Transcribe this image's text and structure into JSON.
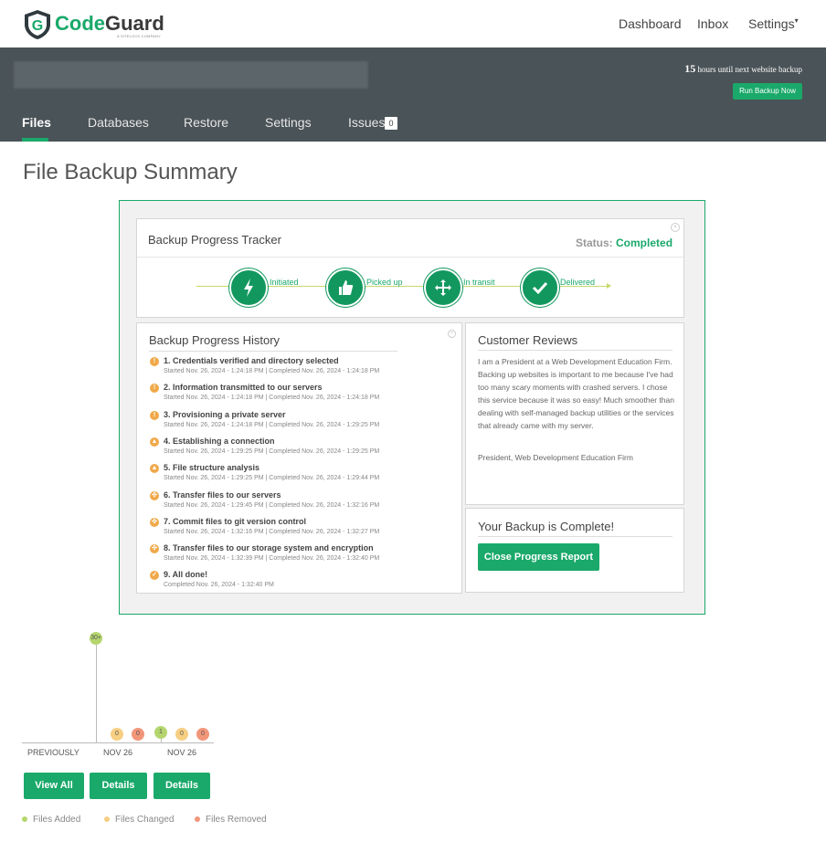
{
  "brand": {
    "name_code": "Code",
    "name_guard": "Guard",
    "tagline": "A SITELOCK COMPANY"
  },
  "topnav": {
    "dashboard": "Dashboard",
    "inbox": "Inbox",
    "settings": "Settings",
    "settings_caret": "▾"
  },
  "header": {
    "hours_value": "15",
    "hours_text": "hours until next website backup",
    "run_backup_label": "Run Backup Now"
  },
  "tabs": [
    {
      "label": "Files"
    },
    {
      "label": "Databases"
    },
    {
      "label": "Restore"
    },
    {
      "label": "Settings"
    },
    {
      "label": "Issues"
    }
  ],
  "issues_count": "0",
  "page_title": "File Backup Summary",
  "tracker": {
    "title": "Backup Progress Tracker",
    "status_label": "Status:",
    "status_value": "Completed",
    "steps": [
      {
        "label": "Initiated",
        "icon": "lightning-icon"
      },
      {
        "label": "Picked up",
        "icon": "thumbs-up-icon"
      },
      {
        "label": "In transit",
        "icon": "move-arrows-icon"
      },
      {
        "label": "Delivered",
        "icon": "checkmark-icon"
      }
    ]
  },
  "history": {
    "title": "Backup Progress History",
    "items": [
      {
        "title": "1. Credentials verified and directory selected",
        "sub": "Started Nov. 26, 2024 - 1:24:18 PM | Completed Nov. 26, 2024 - 1:24:18 PM",
        "icon": "!",
        "color": "#f0a94a"
      },
      {
        "title": "2. Information transmitted to our servers",
        "sub": "Started Nov. 26, 2024 - 1:24:18 PM | Completed Nov. 26, 2024 - 1:24:18 PM",
        "icon": "!",
        "color": "#f0a94a"
      },
      {
        "title": "3. Provisioning a private server",
        "sub": "Started Nov. 26, 2024 - 1:24:18 PM | Completed Nov. 26, 2024 - 1:29:25 PM",
        "icon": "!",
        "color": "#f0a94a"
      },
      {
        "title": "4. Establishing a connection",
        "sub": "Started Nov. 26, 2024 - 1:29:25 PM | Completed Nov. 26, 2024 - 1:29:25 PM",
        "icon": "▲",
        "color": "#f0a94a"
      },
      {
        "title": "5. File structure analysis",
        "sub": "Started Nov. 26, 2024 - 1:29:25 PM | Completed Nov. 26, 2024 - 1:29:44 PM",
        "icon": "▲",
        "color": "#f0a94a"
      },
      {
        "title": "6. Transfer files to our servers",
        "sub": "Started Nov. 26, 2024 - 1:29:45 PM | Completed Nov. 26, 2024 - 1:32:16 PM",
        "icon": "✣",
        "color": "#f0a94a"
      },
      {
        "title": "7. Commit files to git version control",
        "sub": "Started Nov. 26, 2024 - 1:32:16 PM | Completed Nov. 26, 2024 - 1:32:27 PM",
        "icon": "✣",
        "color": "#f0a94a"
      },
      {
        "title": "8. Transfer files to our storage system and encryption",
        "sub": "Started Nov. 26, 2024 - 1:32:39 PM | Completed Nov. 26, 2024 - 1:32:40 PM",
        "icon": "✣",
        "color": "#f0a94a"
      },
      {
        "title": "9. All done!",
        "sub": "Completed Nov. 26, 2024 - 1:32:40 PM",
        "icon": "✓",
        "color": "#f0a94a"
      }
    ]
  },
  "reviews": {
    "title": "Customer Reviews",
    "text": "I am a President at a Web Development Education Firm. Backing up websites is important to me because I've had too many scary moments with crashed servers. I chose this service because it was so easy! Much smoother than dealing with self-managed backup utilities or the services that already came with my server.",
    "author": "President, Web Development Education Firm"
  },
  "complete": {
    "title": "Your Backup is Complete!",
    "button": "Close Progress Report"
  },
  "chart_data": {
    "type": "bubble-timeline",
    "columns": [
      {
        "label": "PREVIOUSLY",
        "added": "30+",
        "changed": null,
        "removed": null
      },
      {
        "label": "NOV 26",
        "added": null,
        "changed": "0",
        "removed": "0"
      },
      {
        "label": "NOV 26",
        "added": "1",
        "changed": "0",
        "removed": "0"
      }
    ],
    "colors": {
      "added": "#b5d66f",
      "changed": "#f7cf83",
      "removed": "#f2967a"
    }
  },
  "chart_buttons": {
    "view_all": "View All",
    "details1": "Details",
    "details2": "Details"
  },
  "legend": {
    "added": "Files Added",
    "changed": "Files Changed",
    "removed": "Files Removed"
  }
}
